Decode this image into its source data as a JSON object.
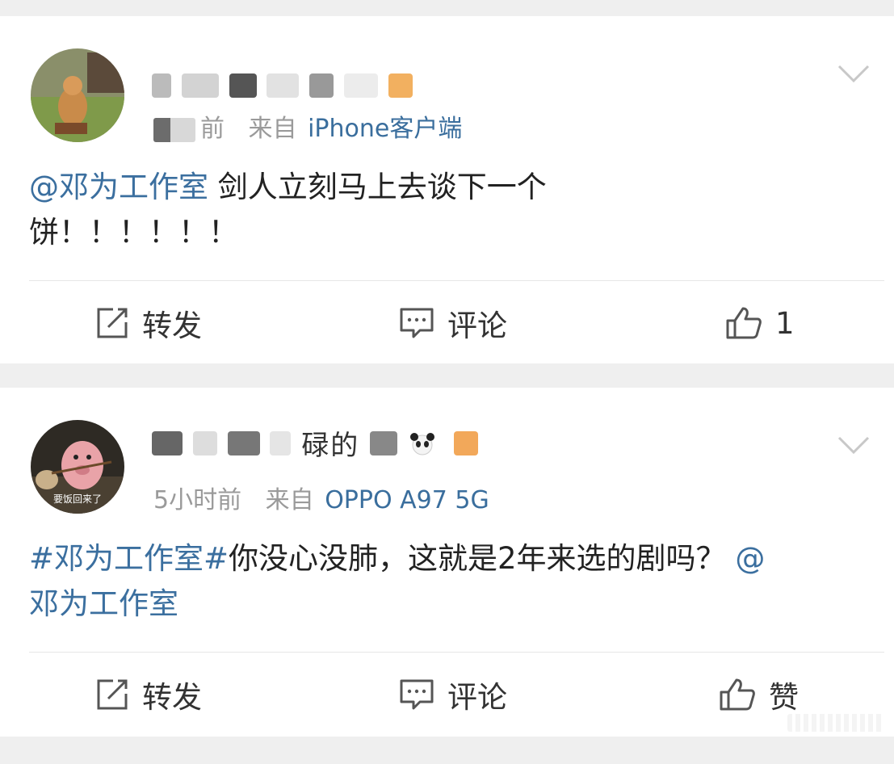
{
  "posts": [
    {
      "time_label": "前",
      "source_prefix": "来自",
      "source_device": "iPhone客户端",
      "mention": "@邓为工作室",
      "text_line1": " 剑人立刻马上去谈下一个",
      "text_line2": "饼！！！！！！",
      "actions": {
        "repost": "转发",
        "comment": "评论",
        "like": "1"
      }
    },
    {
      "time_label": "5小时前",
      "source_prefix": "来自",
      "source_device": "OPPO A97 5G",
      "hashtag": "#邓为工作室#",
      "text_body": "你没心没肺，这就是2年来选的剧吗？",
      "mention_end": "@",
      "mention_line2": "邓为工作室",
      "actions": {
        "repost": "转发",
        "comment": "评论",
        "like": "赞"
      }
    }
  ],
  "avatar2_caption": "要饭回来了",
  "username2_visible": "碌的",
  "colors": {
    "link": "#3b6f9f",
    "meta": "#9a9a9a",
    "background": "#efefef"
  }
}
